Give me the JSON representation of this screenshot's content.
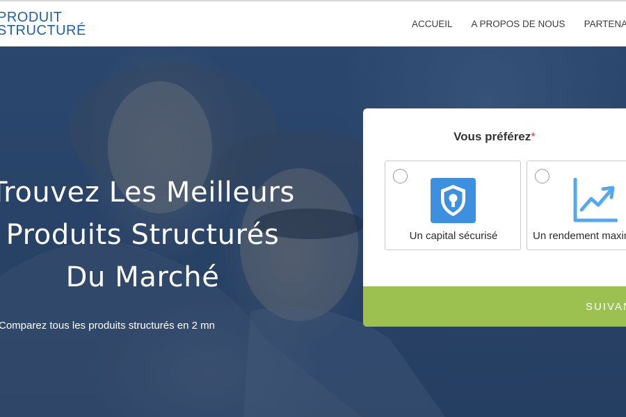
{
  "logo": {
    "line1": "PRODUIT",
    "line2": "STRUCTURÉ"
  },
  "nav": {
    "items": [
      "ACCUEIL",
      "A PROPOS DE NOUS",
      "PARTENAIRES"
    ]
  },
  "hero": {
    "headline": [
      "Trouvez Les Meilleurs",
      "Produits Structurés",
      "Du Marché"
    ],
    "subline": "Comparez tous les produits structurés en 2 mn"
  },
  "form": {
    "question": "Vous préférez",
    "required_mark": "*",
    "options": [
      {
        "label": "Un capital sécurisé",
        "icon": "shield-lock-icon",
        "selected": false
      },
      {
        "label": "Un rendement maximal",
        "icon": "growth-chart-icon",
        "selected": false
      }
    ],
    "next_label": "SUIVANT"
  },
  "colors": {
    "brand_blue": "#1f5fa6",
    "hero_bg": "#2a4468",
    "button_green": "#9cc151",
    "required_red": "#e0393b",
    "icon_blue": "#3d8fe0"
  }
}
